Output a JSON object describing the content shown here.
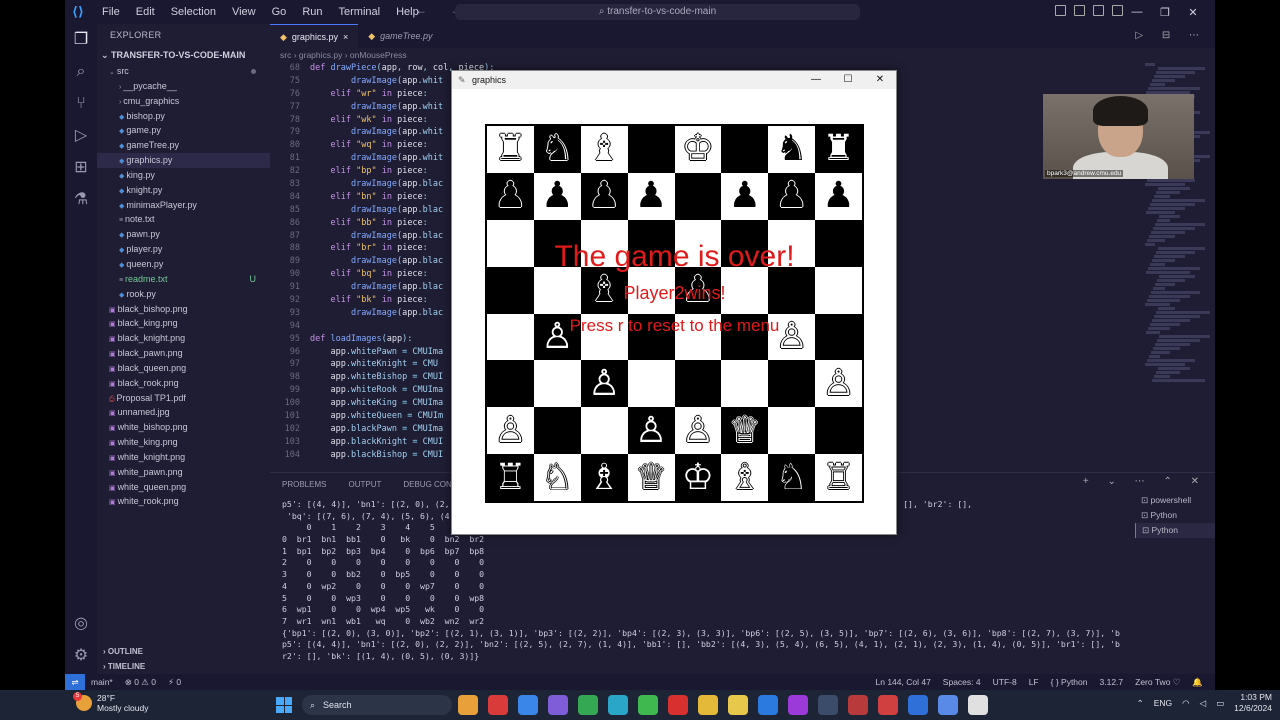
{
  "vscode": {
    "menu": [
      "File",
      "Edit",
      "Selection",
      "View",
      "Go",
      "Run",
      "Terminal",
      "Help"
    ],
    "command_center": "transfer-to-vs-code-main",
    "explorer_title": "EXPLORER",
    "root_folder": "TRANSFER-TO-VS-CODE-MAIN",
    "tree": [
      {
        "label": "src",
        "indent": 1,
        "arrow": "⌄"
      },
      {
        "label": "__pycache__",
        "indent": 2,
        "arrow": "›"
      },
      {
        "label": "cmu_graphics",
        "indent": 2,
        "arrow": "›"
      },
      {
        "label": "bishop.py",
        "indent": 2,
        "py": true
      },
      {
        "label": "game.py",
        "indent": 2,
        "py": true
      },
      {
        "label": "gameTree.py",
        "indent": 2,
        "py": true
      },
      {
        "label": "graphics.py",
        "indent": 2,
        "py": true,
        "selected": true
      },
      {
        "label": "king.py",
        "indent": 2,
        "py": true
      },
      {
        "label": "knight.py",
        "indent": 2,
        "py": true
      },
      {
        "label": "minimaxPlayer.py",
        "indent": 2,
        "py": true
      },
      {
        "label": "note.txt",
        "indent": 2
      },
      {
        "label": "pawn.py",
        "indent": 2,
        "py": true
      },
      {
        "label": "player.py",
        "indent": 2,
        "py": true
      },
      {
        "label": "queen.py",
        "indent": 2,
        "py": true
      },
      {
        "label": "readme.txt",
        "indent": 2,
        "badge": "U",
        "green": true
      },
      {
        "label": "rook.py",
        "indent": 2,
        "py": true
      },
      {
        "label": "black_bishop.png",
        "indent": 1,
        "img": true
      },
      {
        "label": "black_king.png",
        "indent": 1,
        "img": true
      },
      {
        "label": "black_knight.png",
        "indent": 1,
        "img": true
      },
      {
        "label": "black_pawn.png",
        "indent": 1,
        "img": true
      },
      {
        "label": "black_queen.png",
        "indent": 1,
        "img": true
      },
      {
        "label": "black_rook.png",
        "indent": 1,
        "img": true
      },
      {
        "label": "Proposal TP1.pdf",
        "indent": 1,
        "pdf": true
      },
      {
        "label": "unnamed.jpg",
        "indent": 1,
        "img": true
      },
      {
        "label": "white_bishop.png",
        "indent": 1,
        "img": true
      },
      {
        "label": "white_king.png",
        "indent": 1,
        "img": true
      },
      {
        "label": "white_knight.png",
        "indent": 1,
        "img": true
      },
      {
        "label": "white_pawn.png",
        "indent": 1,
        "img": true
      },
      {
        "label": "white_queen.png",
        "indent": 1,
        "img": true
      },
      {
        "label": "white_rook.png",
        "indent": 1,
        "img": true
      }
    ],
    "outline_label": "OUTLINE",
    "timeline_label": "TIMELINE",
    "tabs": [
      {
        "label": "graphics.py",
        "active": true,
        "close": "×"
      },
      {
        "label": "gameTree.py",
        "active": false,
        "close": ""
      }
    ],
    "breadcrumb": "src  ›  graphics.py  ›  onMousePress",
    "code_lines": [
      {
        "n": "68",
        "t": "def drawPiece(app, row, col, piece):"
      },
      {
        "n": "75",
        "t": "        drawImage(app.whit"
      },
      {
        "n": "76",
        "t": "    elif \"wr\" in piece:"
      },
      {
        "n": "77",
        "t": "        drawImage(app.whit"
      },
      {
        "n": "78",
        "t": "    elif \"wk\" in piece:"
      },
      {
        "n": "79",
        "t": "        drawImage(app.whit"
      },
      {
        "n": "80",
        "t": "    elif \"wq\" in piece:"
      },
      {
        "n": "81",
        "t": "        drawImage(app.whit"
      },
      {
        "n": "82",
        "t": "    elif \"bp\" in piece:"
      },
      {
        "n": "83",
        "t": "        drawImage(app.blac"
      },
      {
        "n": "84",
        "t": "    elif \"bn\" in piece:"
      },
      {
        "n": "85",
        "t": "        drawImage(app.blac"
      },
      {
        "n": "86",
        "t": "    elif \"bb\" in piece:"
      },
      {
        "n": "87",
        "t": "        drawImage(app.blac"
      },
      {
        "n": "88",
        "t": "    elif \"br\" in piece:"
      },
      {
        "n": "89",
        "t": "        drawImage(app.blac"
      },
      {
        "n": "90",
        "t": "    elif \"bq\" in piece:"
      },
      {
        "n": "91",
        "t": "        drawImage(app.blac"
      },
      {
        "n": "92",
        "t": "    elif \"bk\" in piece:"
      },
      {
        "n": "93",
        "t": "        drawImage(app.blac"
      },
      {
        "n": "94",
        "t": ""
      },
      {
        "n": "95",
        "t": "def loadImages(app):"
      },
      {
        "n": "96",
        "t": "    app.whitePawn = CMUIma"
      },
      {
        "n": "97",
        "t": "    app.whiteKnight = CMU"
      },
      {
        "n": "98",
        "t": "    app.whiteBishop = CMUI"
      },
      {
        "n": "99",
        "t": "    app.whiteRook = CMUIma"
      },
      {
        "n": "100",
        "t": "    app.whiteKing = CMUIma"
      },
      {
        "n": "101",
        "t": "    app.whiteQueen = CMUIm"
      },
      {
        "n": "102",
        "t": "    app.blackPawn = CMUIma"
      },
      {
        "n": "103",
        "t": "    app.blackKnight = CMUI"
      },
      {
        "n": "104",
        "t": "    app.blackBishop = CMUI"
      }
    ],
    "panel_tabs": [
      "PROBLEMS",
      "OUTPUT",
      "DEBUG CONSOLE"
    ],
    "terminal_lines": [
      "p5': [(4, 4)], 'bn1': [(2, 0), (2,                                                            (2, 3), (1, 4), (0, 5)], 'br1': [], 'br2': [],",
      " 'bq': [(7, 6), (7, 4), (5, 6), (4                                                            (1, 4), (0, 5), (0, 3)]}",
      "     0    1    2    3    4    5",
      "0  br1  bn1  bb1    0   bk    0  bn2  br2",
      "1  bp1  bp2  bp3  bp4    0  bp6  bp7  bp8",
      "2    0    0    0    0    0    0    0    0",
      "3    0    0  bb2    0  bp5    0    0    0",
      "4    0  wp2    0    0    0  wp7    0    0",
      "5    0    0  wp3    0    0    0    0  wp8",
      "6  wp1    0    0  wp4  wp5   wk    0    0",
      "7  wr1  wn1  wb1   wq    0  wb2  wn2  wr2",
      "{'bp1': [(2, 0), (3, 0)], 'bp2': [(2, 1), (3, 1)], 'bp3': [(2, 2)], 'bp4': [(2, 3), (3, 3)], 'bp6': [(2, 5), (3, 5)], 'bp7': [(2, 6), (3, 6)], 'bp8': [(2, 7), (3, 7)], 'b",
      "p5': [(4, 4)], 'bn1': [(2, 0), (2, 2)], 'bn2': [(2, 5), (2, 7), (1, 4)], 'bb1': [], 'bb2': [(4, 3), (5, 4), (6, 5), (4, 1), (2, 1), (2, 3), (1, 4), (0, 5)], 'br1': [], 'b",
      "r2': [], 'bk': [(1, 4), (0, 5), (0, 3)]}"
    ],
    "terminal_list": [
      "powershell",
      "Python",
      "Python"
    ],
    "status_left": [
      "main*",
      "⊗ 0  ⚠ 0",
      "⚡ 0"
    ],
    "status_right": [
      "Ln 144, Col 47",
      "Spaces: 4",
      "UTF-8",
      "LF",
      "{ } Python",
      "3.12.7",
      "Zero Two ♡"
    ]
  },
  "graphics_window": {
    "title": "graphics",
    "board": [
      [
        "♜",
        "♞",
        "♝",
        "",
        "♚",
        "",
        "♞",
        "♜"
      ],
      [
        "♟",
        "♟",
        "♟",
        "♟",
        "",
        "♟",
        "♟",
        "♟"
      ],
      [
        "",
        "",
        "",
        "",
        "",
        "",
        "",
        ""
      ],
      [
        "",
        "",
        "♝",
        "",
        "♟",
        "",
        "",
        ""
      ],
      [
        "",
        "♙",
        "",
        "",
        "",
        "",
        "♙",
        ""
      ],
      [
        "",
        "",
        "♙",
        "",
        "",
        "",
        "",
        "♙"
      ],
      [
        "♙",
        "",
        "",
        "♙",
        "♙",
        "♕",
        "",
        ""
      ],
      [
        "♖",
        "♘",
        "♗",
        "♕",
        "♔",
        "♗",
        "♘",
        "♖"
      ]
    ],
    "board_colors": [
      [
        "w",
        "b",
        "w",
        "",
        "w",
        "",
        "b",
        "w"
      ],
      [
        "b",
        "b",
        "b",
        "b",
        "",
        "b",
        "b",
        "b"
      ],
      [
        "",
        "",
        "",
        "",
        "",
        "",
        "",
        ""
      ],
      [
        "",
        "",
        "b",
        "",
        "b",
        "",
        "",
        ""
      ],
      [
        "",
        "w",
        "",
        "",
        "",
        "",
        "w",
        ""
      ],
      [
        "",
        "",
        "w",
        "",
        "",
        "",
        "",
        "w"
      ],
      [
        "w",
        "",
        "",
        "w",
        "w",
        "b",
        "",
        ""
      ],
      [
        "w",
        "w",
        "w",
        "w",
        "w",
        "w",
        "w",
        "w"
      ]
    ],
    "message_title": "The game is over!",
    "message_winner": "Player2wins!",
    "message_reset": "Press r to reset to the menu"
  },
  "webcam_label": "bpark3@andrew.cmu.edu",
  "taskbar": {
    "weather_temp": "28°F",
    "weather_desc": "Mostly cloudy",
    "weather_badge": "5",
    "search_label": "Search",
    "apps": [
      "#e8a13a",
      "#d93a3a",
      "#3a86e8",
      "#7f5cd8",
      "#34a853",
      "#2aa7c8",
      "#3fb94f",
      "#d8302f",
      "#e4b93a",
      "#e8c84a",
      "#2a7ae0",
      "#9b3ad8",
      "#3a4c6a",
      "#b83a3a",
      "#d04040",
      "#2f6fd8",
      "#5a8ae8",
      "#e0e0e0"
    ],
    "tray": [
      "ENG"
    ],
    "time": "1:03 PM",
    "date": "12/6/2024"
  }
}
